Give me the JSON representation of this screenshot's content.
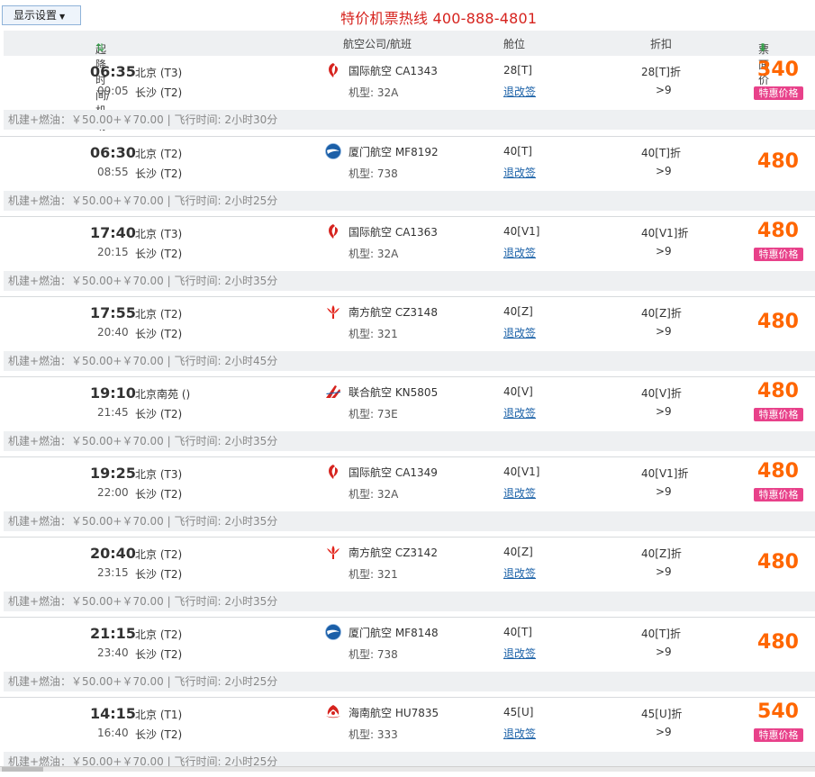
{
  "toolbar": {
    "settings_label": "显示设置",
    "hotline": "特价机票热线 400-888-4801"
  },
  "header": {
    "col_time": "起降时间/机场",
    "col_time_sort": "⇅",
    "col_airline": "航空公司/航班",
    "col_cabin": "舱位",
    "col_discount": "折扣",
    "col_price": "票面价",
    "col_price_sort": "⬇"
  },
  "flights": [
    {
      "dep_time": "06:35",
      "dep_airport": "北京 (T3)",
      "arr_time": "09:05",
      "arr_airport": "长沙 (T2)",
      "logo": "airchina",
      "airline": "国际航空 CA1343",
      "model": "机型:  32A",
      "cabin": "28[T]",
      "change": "退改签",
      "discount": "28[T]折",
      "discount2": ">9",
      "price": "340",
      "special": "特惠价格",
      "footer": "机建+燃油：￥50.00+￥70.00 | 飞行时间:  2小时30分"
    },
    {
      "dep_time": "06:30",
      "dep_airport": "北京 (T2)",
      "arr_time": "08:55",
      "arr_airport": "长沙 (T2)",
      "logo": "xiamen",
      "airline": "厦门航空 MF8192",
      "model": "机型:  738",
      "cabin": "40[T]",
      "change": "退改签",
      "discount": "40[T]折",
      "discount2": ">9",
      "price": "480",
      "special": null,
      "footer": "机建+燃油：￥50.00+￥70.00 | 飞行时间:  2小时25分"
    },
    {
      "dep_time": "17:40",
      "dep_airport": "北京 (T3)",
      "arr_time": "20:15",
      "arr_airport": "长沙 (T2)",
      "logo": "airchina",
      "airline": "国际航空 CA1363",
      "model": "机型:  32A",
      "cabin": "40[V1]",
      "change": "退改签",
      "discount": "40[V1]折",
      "discount2": ">9",
      "price": "480",
      "special": "特惠价格",
      "footer": "机建+燃油：￥50.00+￥70.00 | 飞行时间:  2小时35分"
    },
    {
      "dep_time": "17:55",
      "dep_airport": "北京 (T2)",
      "arr_time": "20:40",
      "arr_airport": "长沙 (T2)",
      "logo": "southern",
      "airline": "南方航空 CZ3148",
      "model": "机型:  321",
      "cabin": "40[Z]",
      "change": "退改签",
      "discount": "40[Z]折",
      "discount2": ">9",
      "price": "480",
      "special": null,
      "footer": "机建+燃油：￥50.00+￥70.00 | 飞行时间:  2小时45分"
    },
    {
      "dep_time": "19:10",
      "dep_airport": "北京南苑 ()",
      "arr_time": "21:45",
      "arr_airport": "长沙 (T2)",
      "logo": "united",
      "airline": "联合航空 KN5805",
      "model": "机型:  73E",
      "cabin": "40[V]",
      "change": "退改签",
      "discount": "40[V]折",
      "discount2": ">9",
      "price": "480",
      "special": "特惠价格",
      "footer": "机建+燃油：￥50.00+￥70.00 | 飞行时间:  2小时35分"
    },
    {
      "dep_time": "19:25",
      "dep_airport": "北京 (T3)",
      "arr_time": "22:00",
      "arr_airport": "长沙 (T2)",
      "logo": "airchina",
      "airline": "国际航空 CA1349",
      "model": "机型:  32A",
      "cabin": "40[V1]",
      "change": "退改签",
      "discount": "40[V1]折",
      "discount2": ">9",
      "price": "480",
      "special": "特惠价格",
      "footer": "机建+燃油：￥50.00+￥70.00 | 飞行时间:  2小时35分"
    },
    {
      "dep_time": "20:40",
      "dep_airport": "北京 (T2)",
      "arr_time": "23:15",
      "arr_airport": "长沙 (T2)",
      "logo": "southern",
      "airline": "南方航空 CZ3142",
      "model": "机型:  321",
      "cabin": "40[Z]",
      "change": "退改签",
      "discount": "40[Z]折",
      "discount2": ">9",
      "price": "480",
      "special": null,
      "footer": "机建+燃油：￥50.00+￥70.00 | 飞行时间:  2小时35分"
    },
    {
      "dep_time": "21:15",
      "dep_airport": "北京 (T2)",
      "arr_time": "23:40",
      "arr_airport": "长沙 (T2)",
      "logo": "xiamen",
      "airline": "厦门航空 MF8148",
      "model": "机型:  738",
      "cabin": "40[T]",
      "change": "退改签",
      "discount": "40[T]折",
      "discount2": ">9",
      "price": "480",
      "special": null,
      "footer": "机建+燃油：￥50.00+￥70.00 | 飞行时间:  2小时25分"
    },
    {
      "dep_time": "14:15",
      "dep_airport": "北京 (T1)",
      "arr_time": "16:40",
      "arr_airport": "长沙 (T2)",
      "logo": "hainan",
      "airline": "海南航空 HU7835",
      "model": "机型:  333",
      "cabin": "45[U]",
      "change": "退改签",
      "discount": "45[U]折",
      "discount2": ">9",
      "price": "540",
      "special": "特惠价格",
      "footer": "机建+燃油：￥50.00+￥70.00 | 飞行时间:  2小时25分"
    }
  ]
}
